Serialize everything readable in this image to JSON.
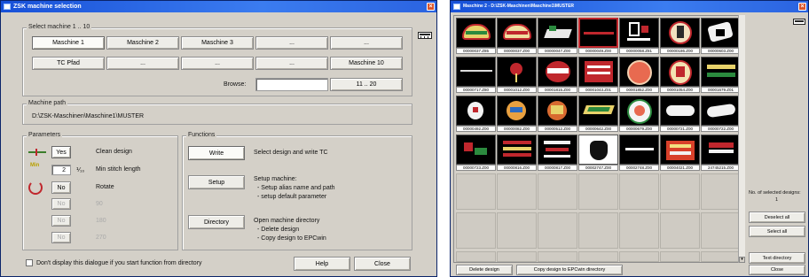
{
  "left_window": {
    "title": "ZSK machine selection",
    "select_group": {
      "label": "Select machine   1 .. 10",
      "row1": [
        "Maschine 1",
        "Maschine 2",
        "Maschine 3",
        "...",
        "..."
      ],
      "row2": [
        "TC Pfad",
        "...",
        "...",
        "...",
        "Maschine 10"
      ],
      "browse_label": "Browse:",
      "browse_button": "11 .. 20"
    },
    "path_group": {
      "label": "Machine path",
      "value": "D:\\ZSK-Maschinen\\Maschine1\\MUSTER"
    },
    "params_group": {
      "label": "Parameters",
      "clean_button": "Yes",
      "clean_label": "Clean design",
      "min_icon": "Min",
      "stitch_value": "2",
      "stitch_unit": "⅟₁₀",
      "stitch_label": "Min stitch length",
      "rotate_button": "No",
      "rotate_label": "Rotate",
      "disabled_rows": [
        {
          "button": "No",
          "label": "90"
        },
        {
          "button": "No",
          "label": "180"
        },
        {
          "button": "No",
          "label": "270"
        }
      ]
    },
    "functions_group": {
      "label": "Functions",
      "write_button": "Write",
      "write_desc": "Select design and write TC",
      "setup_button": "Setup",
      "setup_desc": [
        "Setup machine:",
        "- Setup alias name and path",
        "- setup default parameter"
      ],
      "directory_button": "Directory",
      "directory_desc": [
        "Open machine directory",
        "- Delete design",
        "- Copy design to EPCwin"
      ]
    },
    "footer": {
      "checkbox_label": "Don't display this dialogue if you start function from directory",
      "help_button": "Help",
      "close_button": "Close"
    }
  },
  "right_window": {
    "title": "Maschine 2 - D:\\ZSK-Maschinen\\Maschine1\\MUSTER",
    "thumbnails": [
      [
        "00000037.Z85",
        "00000037.Z00",
        "00000047.Z00",
        "00000049.Z00",
        "00000058.Z81",
        "00000186.Z00",
        "00000603.Z00"
      ],
      [
        "00000717.Z80",
        "00001012.Z00",
        "00001815.Z00",
        "00001043.Z01",
        "00001852.Z00",
        "00001054.Z00",
        "00001679.Z01"
      ],
      [
        "00000492.Z00",
        "00000082.Z00",
        "00000512.Z00",
        "00000642.Z00",
        "00000679.Z00",
        "00000721.Z00",
        "00000722.Z00"
      ],
      [
        "00000723.Z00",
        "00000816.Z00",
        "00000817.Z00",
        "00002747.Z00",
        "00002748.Z00",
        "00004021.Z00",
        "24745215.Z00"
      ]
    ],
    "selected_count_label": "No. of selected designs:",
    "selected_count_value": "1",
    "deselect_button": "Deselect all",
    "select_button": "Select all",
    "textdir_button": "Text directory",
    "close_button": "Close",
    "delete_button": "Delete design",
    "copy_button": "Copy design to EPCwin directory"
  }
}
